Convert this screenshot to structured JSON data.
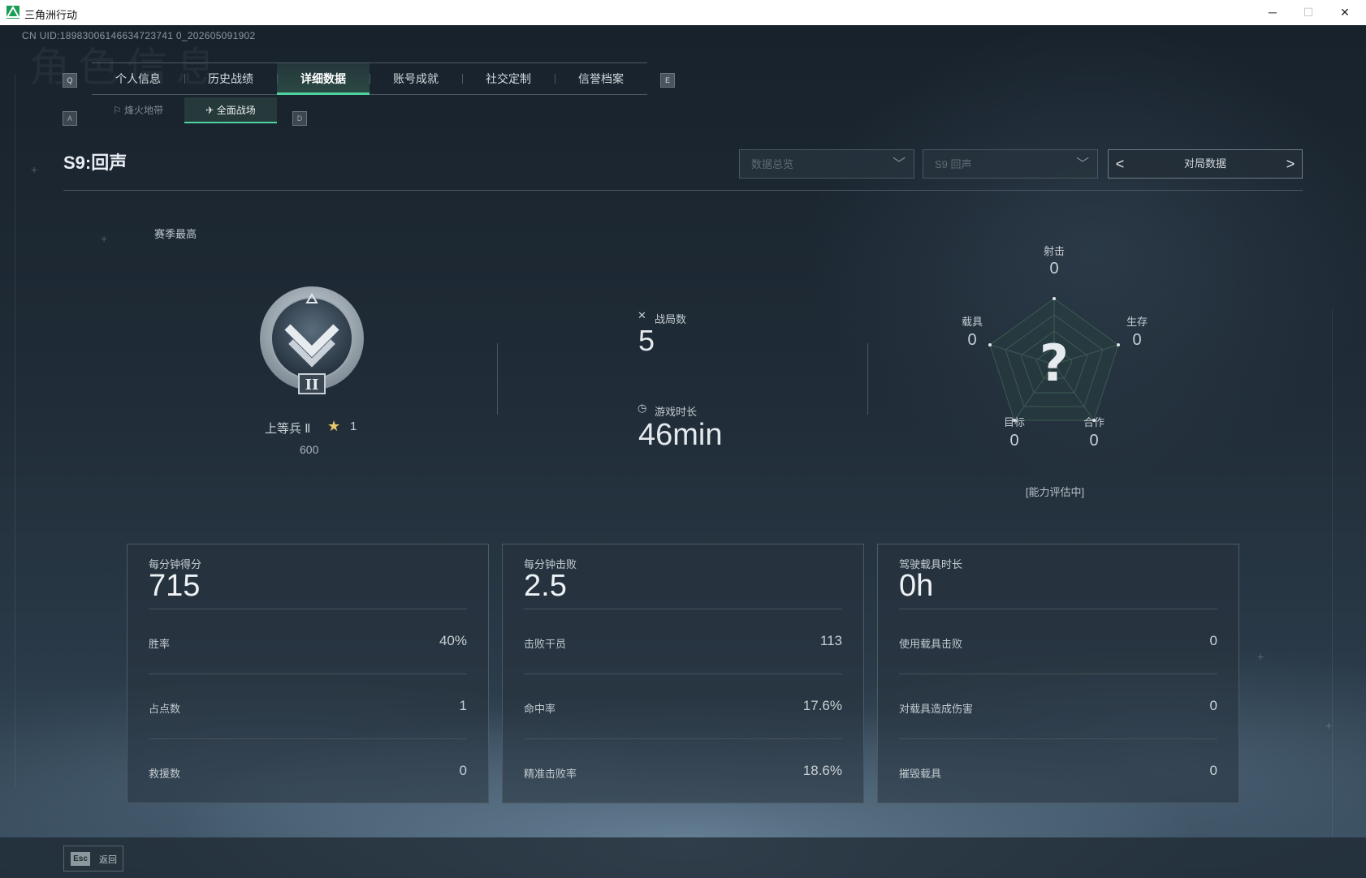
{
  "window": {
    "title": "三角洲行动",
    "minimize": "─",
    "maximize": "☐",
    "close": "✕"
  },
  "uid": "CN UID:18983006146634723741 0_202605091902",
  "watermark": "角色信息",
  "tabs": {
    "left_key": "Q",
    "right_key": "E",
    "items": [
      {
        "label": "个人信息"
      },
      {
        "label": "历史战绩"
      },
      {
        "label": "详细数据",
        "active": true
      },
      {
        "label": "账号成就"
      },
      {
        "label": "社交定制"
      },
      {
        "label": "信誉档案"
      }
    ]
  },
  "subtabs": {
    "left_key": "A",
    "right_key": "D",
    "items": [
      {
        "label": "烽火地带",
        "icon": "flag-icon"
      },
      {
        "label": "全面战场",
        "icon": "airstrike-icon",
        "active": true
      }
    ]
  },
  "season_title": "S9:回声",
  "filters": {
    "overview": "数据总览",
    "season": "S9 回声",
    "pager_label": "对局数据",
    "prev": "<",
    "next": ">"
  },
  "rank": {
    "heading": "赛季最高",
    "name": "上等兵 Ⅱ",
    "stars": "1",
    "points": "600",
    "badge_numeral": "II"
  },
  "summary": {
    "matches_label": "战局数",
    "matches_value": "5",
    "time_label": "游戏时长",
    "time_value": "46min"
  },
  "radar": {
    "center": "?",
    "axes": [
      {
        "label": "射击",
        "value": "0"
      },
      {
        "label": "生存",
        "value": "0"
      },
      {
        "label": "合作",
        "value": "0"
      },
      {
        "label": "目标",
        "value": "0"
      },
      {
        "label": "载具",
        "value": "0"
      }
    ],
    "status": "[能力评估中]"
  },
  "cards": [
    {
      "title": "每分钟得分",
      "value": "715",
      "rows": [
        {
          "label": "胜率",
          "value": "40%"
        },
        {
          "label": "占点数",
          "value": "1"
        },
        {
          "label": "救援数",
          "value": "0"
        }
      ]
    },
    {
      "title": "每分钟击败",
      "value": "2.5",
      "rows": [
        {
          "label": "击败干员",
          "value": "113"
        },
        {
          "label": "命中率",
          "value": "17.6%"
        },
        {
          "label": "精准击败率",
          "value": "18.6%"
        }
      ]
    },
    {
      "title": "驾驶载具时长",
      "value": "0h",
      "rows": [
        {
          "label": "使用载具击败",
          "value": "0"
        },
        {
          "label": "对载具造成伤害",
          "value": "0"
        },
        {
          "label": "摧毁载具",
          "value": "0"
        }
      ]
    }
  ],
  "footer": {
    "key": "Esc",
    "label": "返回"
  },
  "colors": {
    "accent": "#4fd3a1",
    "star": "#e6c86a"
  }
}
